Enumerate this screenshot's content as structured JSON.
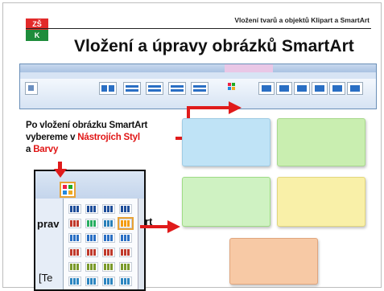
{
  "header": {
    "logo_top": "ZŠ",
    "logo_bottom": "K",
    "topic": "Vložení tvarů a objektů Klipart a SmartArt"
  },
  "slide": {
    "title": "Vložení a úpravy obrázků SmartArt"
  },
  "instruction": {
    "line1": "Po vložení obrázku SmartArt",
    "line2_prefix": "vybereme v ",
    "line2_highlight": "Nástrojích Styl",
    "line3_prefix": "a ",
    "line3_highlight": "Barvy"
  },
  "background_fragments": {
    "left_word": "prav",
    "right_letter": "rt",
    "bottom_word": "[Te"
  },
  "shape_colors": {
    "blue": "#bfe3f6",
    "green": "#c9eeb0",
    "light_green": "#cff2c2",
    "yellow": "#f9f0a8",
    "orange": "#f7c9a5"
  },
  "accent": {
    "arrow_red": "#e01b1b",
    "highlight_red": "#e11515"
  },
  "icons": {
    "ribbon_arrow": "right-arrow-icon",
    "dialog_arrow": "right-arrow-icon",
    "down_arrow": "down-arrow-icon"
  }
}
